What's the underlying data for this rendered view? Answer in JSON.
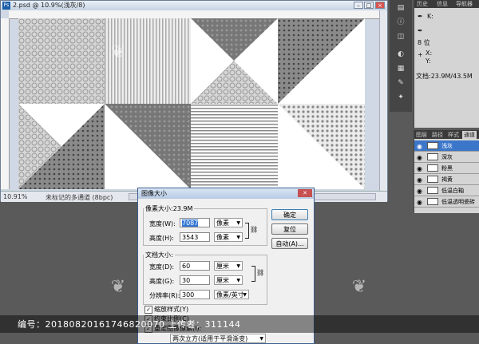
{
  "document": {
    "title": "2.psd @ 10.9%(浅灰/8)",
    "zoom": "10.91%",
    "status": "未标记的多通道 (8bpc)"
  },
  "info_panel": {
    "tabs": [
      "历史",
      "信息",
      "导航器"
    ],
    "k_label": "K:",
    "bits": "8 位",
    "x_label": "X:",
    "y_label": "Y:",
    "doc_size": "文档:23.9M/43.5M"
  },
  "channels": {
    "tabs": [
      "图层",
      "路径",
      "样式",
      "通道"
    ],
    "items": [
      {
        "name": "浅灰",
        "selected": true
      },
      {
        "name": "深灰",
        "selected": false
      },
      {
        "name": "粉黑",
        "selected": false
      },
      {
        "name": "褐黄",
        "selected": false
      },
      {
        "name": "低温白釉",
        "selected": false
      },
      {
        "name": "低温透明瓷砖",
        "selected": false
      }
    ]
  },
  "dialog": {
    "title": "图像大小",
    "pixel_dims_label": "像素大小:23.9M",
    "width_label": "宽度(W):",
    "width_value": "7087",
    "width_unit": "像素",
    "height_label": "高度(H):",
    "height_value": "3543",
    "height_unit": "像素",
    "doc_size_label": "文档大小:",
    "doc_width_label": "宽度(D):",
    "doc_width_value": "60",
    "doc_width_unit": "厘米",
    "doc_height_label": "高度(G):",
    "doc_height_value": "30",
    "doc_height_unit": "厘米",
    "resolution_label": "分辨率(R):",
    "resolution_value": "300",
    "resolution_unit": "像素/英寸",
    "scale_styles": "缩放样式(Y)",
    "constrain": "约束比例(C)",
    "resample": "重定图像像素(I):",
    "resample_method": "两次立方(适用于平滑渐变)",
    "ok": "确定",
    "reset": "复位",
    "auto": "自动(A)..."
  },
  "watermark": {
    "text": "编号：20180820161746820070 上传者：311144"
  }
}
